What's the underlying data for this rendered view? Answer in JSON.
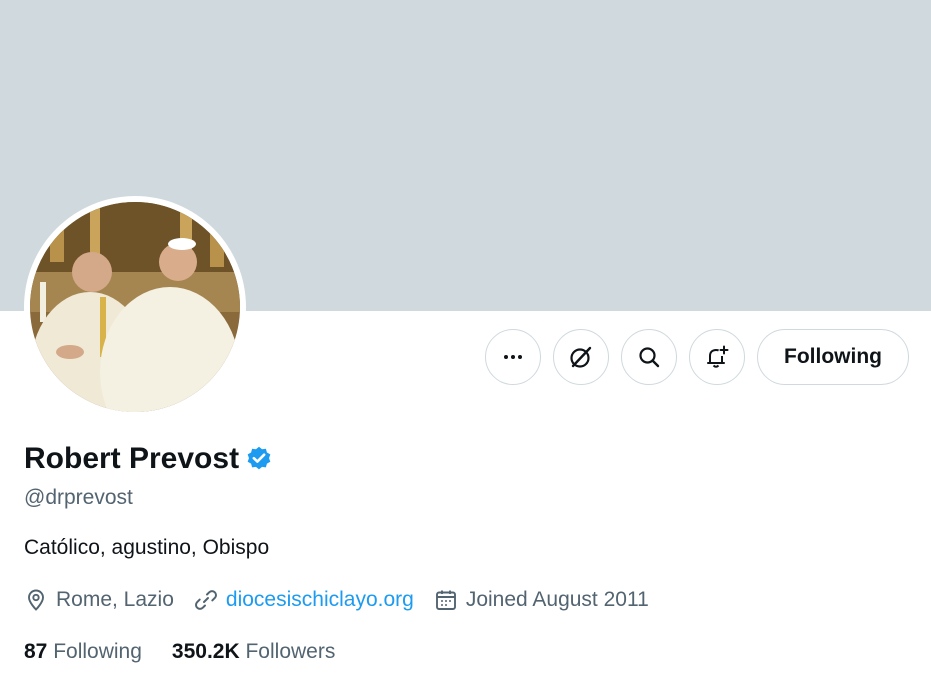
{
  "profile": {
    "name": "Robert Prevost",
    "handle": "@drprevost",
    "bio": "Católico, agustino, Obispo",
    "location": "Rome, Lazio",
    "website": "diocesischiclayo.org",
    "joined": "Joined August 2011",
    "following_count": "87",
    "following_label": "Following",
    "followers_count": "350.2K",
    "followers_label": "Followers"
  },
  "actions": {
    "follow_button": "Following",
    "icons": [
      "more-icon",
      "grok-icon",
      "search-icon",
      "notification-plus-icon"
    ]
  },
  "colors": {
    "banner": "#cfd9de",
    "link": "#1d9bf0",
    "verified": "#1d9bf0",
    "secondary_text": "#536471"
  }
}
